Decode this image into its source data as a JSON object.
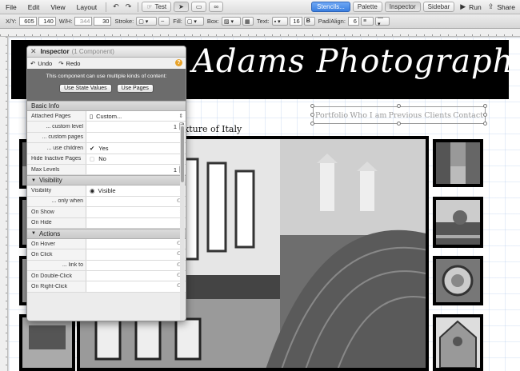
{
  "menu": {
    "items": [
      "File",
      "Edit",
      "View",
      "Layout"
    ],
    "test_label": "Test",
    "stencils_label": "Stencils...",
    "palette_label": "Palette",
    "inspector_label": "Inspector",
    "sidebar_label": "Sidebar",
    "run_label": "Run",
    "share_label": "Share"
  },
  "propbar": {
    "xy_label": "X/Y:",
    "x": "605",
    "y": "140",
    "wh_label": "W/H:",
    "w": "344",
    "h": "30",
    "stroke_label": "Stroke:",
    "fill_label": "Fill:",
    "box_label": "Box:",
    "text_label": "Text:",
    "text_size": "16",
    "pad_label": "Pad/Align:",
    "pad": "6"
  },
  "site": {
    "title": "Adams Photography",
    "nav": [
      "Portfolio",
      "Who I am",
      "Previous Clients",
      "Contact"
    ],
    "subtitle": "xture of Italy"
  },
  "inspector": {
    "title": "Inspector",
    "subtitle": "(1 Component)",
    "undo": "Undo",
    "redo": "Redo",
    "help": "?",
    "notice": "This component can use multiple kinds of content:",
    "use_state_values": "Use State Values",
    "use_pages": "Use Pages",
    "basic_info": "Basic Info",
    "attached_pages_label": "Attached Pages",
    "attached_pages_value": "Custom...",
    "custom_level_label": "... custom level",
    "custom_level_value": "1",
    "custom_pages_label": "... custom pages",
    "use_children_label": "... use children",
    "use_children_value": "Yes",
    "hide_inactive_label": "Hide Inactive Pages",
    "hide_inactive_value": "No",
    "max_levels_label": "Max Levels",
    "max_levels_value": "1",
    "visibility_header": "Visibility",
    "visibility_label": "Visibility",
    "visibility_value": "Visible",
    "only_when_label": "... only when",
    "on_show_label": "On Show",
    "on_hide_label": "On Hide",
    "actions_header": "Actions",
    "on_hover_label": "On Hover",
    "on_click_label": "On Click",
    "link_to_label": "... link to",
    "on_double_click_label": "On Double-Click",
    "on_right_click_label": "On Right-Click"
  },
  "colors": {
    "header_bg": "#000000",
    "accent_blue": "#3a7fe0",
    "help_orange": "#e8a32a"
  }
}
